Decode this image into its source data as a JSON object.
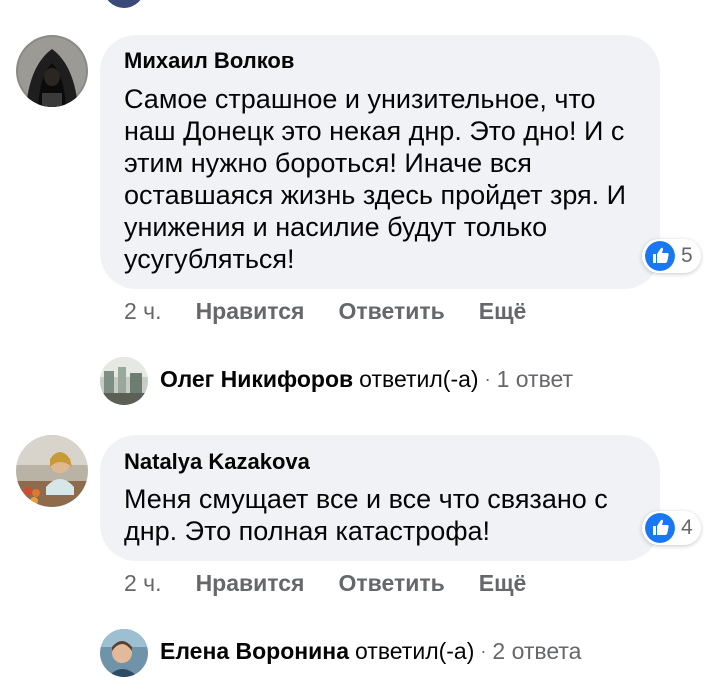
{
  "comments": [
    {
      "author": "Михаил Волков",
      "text": "Самое страшное и унизительное, что наш Донецк это некая днр. Это дно! И с этим нужно бороться! Иначе вся оставшаяся жизнь здесь пройдет зря. И унижения и насилие будут только усугубляться!",
      "reaction_count": "5",
      "time": "2 ч.",
      "like_label": "Нравится",
      "reply_label": "Ответить",
      "more_label": "Ещё",
      "reply_summary": {
        "name": "Олег Никифоров",
        "action": "ответил(-а)",
        "separator": "·",
        "count": "1 ответ"
      }
    },
    {
      "author": "Natalya Kazakova",
      "text": "Меня смущает все и все что связано с днр. Это полная катастрофа!",
      "reaction_count": "4",
      "time": "2 ч.",
      "like_label": "Нравится",
      "reply_label": "Ответить",
      "more_label": "Ещё",
      "reply_summary": {
        "name": "Елена Воронина",
        "action": "ответил(-а)",
        "separator": "·",
        "count": "2 ответа"
      }
    }
  ],
  "colors": {
    "bubble": "#f0f2f5",
    "secondary_text": "#65676b",
    "like_blue": "#1877f2"
  },
  "icons": {
    "reaction": "like-icon"
  }
}
